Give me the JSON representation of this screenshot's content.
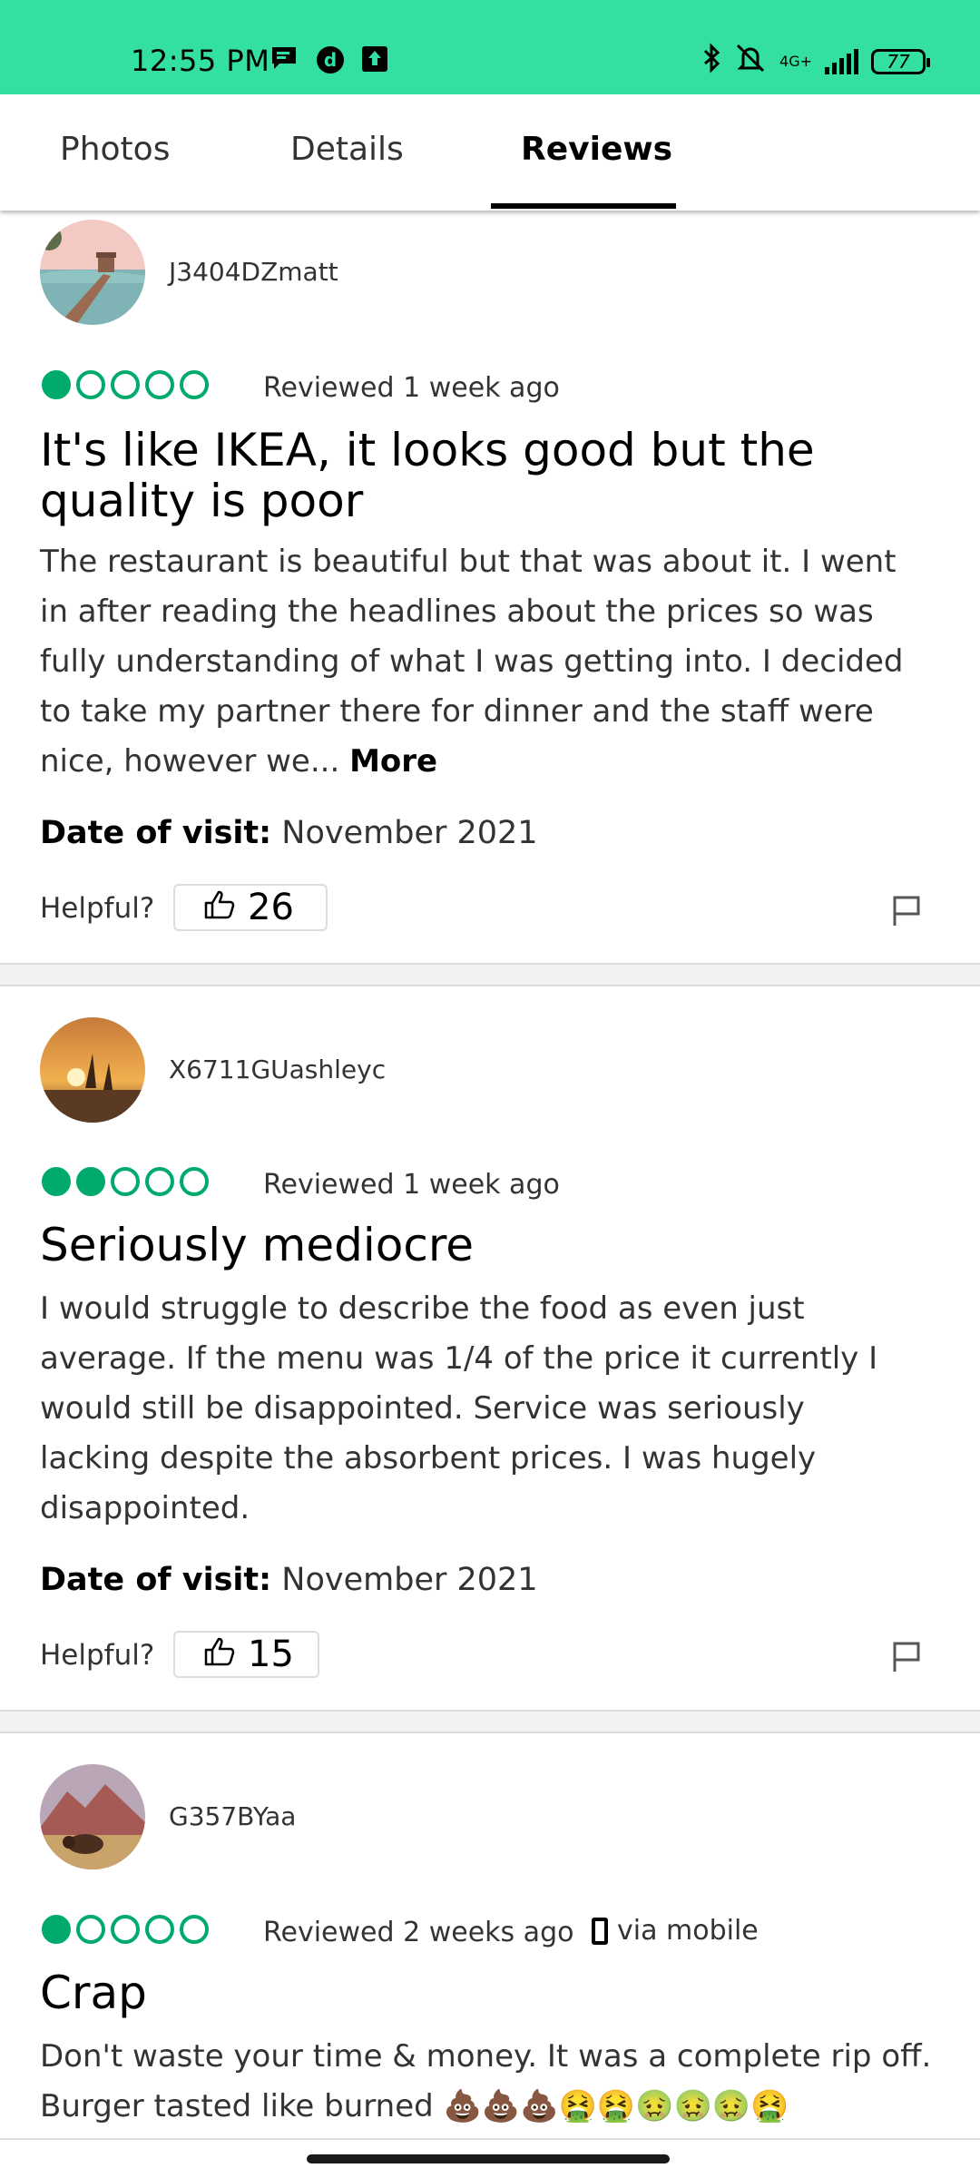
{
  "status_bar": {
    "time": "12:55 PM",
    "network": "4G+",
    "battery": "77",
    "bg_color": "#34e0a1"
  },
  "tabs": [
    {
      "label": "Photos"
    },
    {
      "label": "Details"
    },
    {
      "label": "Reviews",
      "active": true
    }
  ],
  "reviews": [
    {
      "username": "J3404DZmatt",
      "rating": 1,
      "reviewed": "Reviewed 1 week ago",
      "title_lines": [
        "It's like IKEA, it looks good but the",
        "quality is poor"
      ],
      "body_lines": [
        "The restaurant is beautiful but that was about it. I went",
        "in after reading the headlines about the prices so was",
        "fully understanding of what I was getting into. I decided",
        "to take my partner there for dinner and the staff were",
        "nice, however we..."
      ],
      "more_label": "More",
      "visit_label": "Date of visit:",
      "visit_value": "November 2021",
      "helpful_label": "Helpful?",
      "helpful_count": "26"
    },
    {
      "username": "X6711GUashleyc",
      "rating": 2,
      "reviewed": "Reviewed 1 week ago",
      "title_lines": [
        "Seriously mediocre"
      ],
      "body_lines": [
        "I would struggle to describe the food as even just",
        "average. If the menu was 1/4 of the price it currently I",
        "would still be disappointed. Service was seriously",
        "lacking despite the absorbent prices. I was hugely",
        "disappointed."
      ],
      "visit_label": "Date of visit:",
      "visit_value": "November 2021",
      "helpful_label": "Helpful?",
      "helpful_count": "15"
    },
    {
      "username": "G357BYaa",
      "rating": 1,
      "reviewed": "Reviewed 2 weeks ago",
      "via": "via mobile",
      "title_lines": [
        "Crap"
      ],
      "body_lines": [
        "Don't waste your time & money. It was a complete rip off.",
        "Burger tasted like burned"
      ],
      "body_emojis": "💩💩💩🤮🤮🤢🤢🤢🤮"
    }
  ],
  "colors": {
    "rating_green": "#00aa6c"
  }
}
